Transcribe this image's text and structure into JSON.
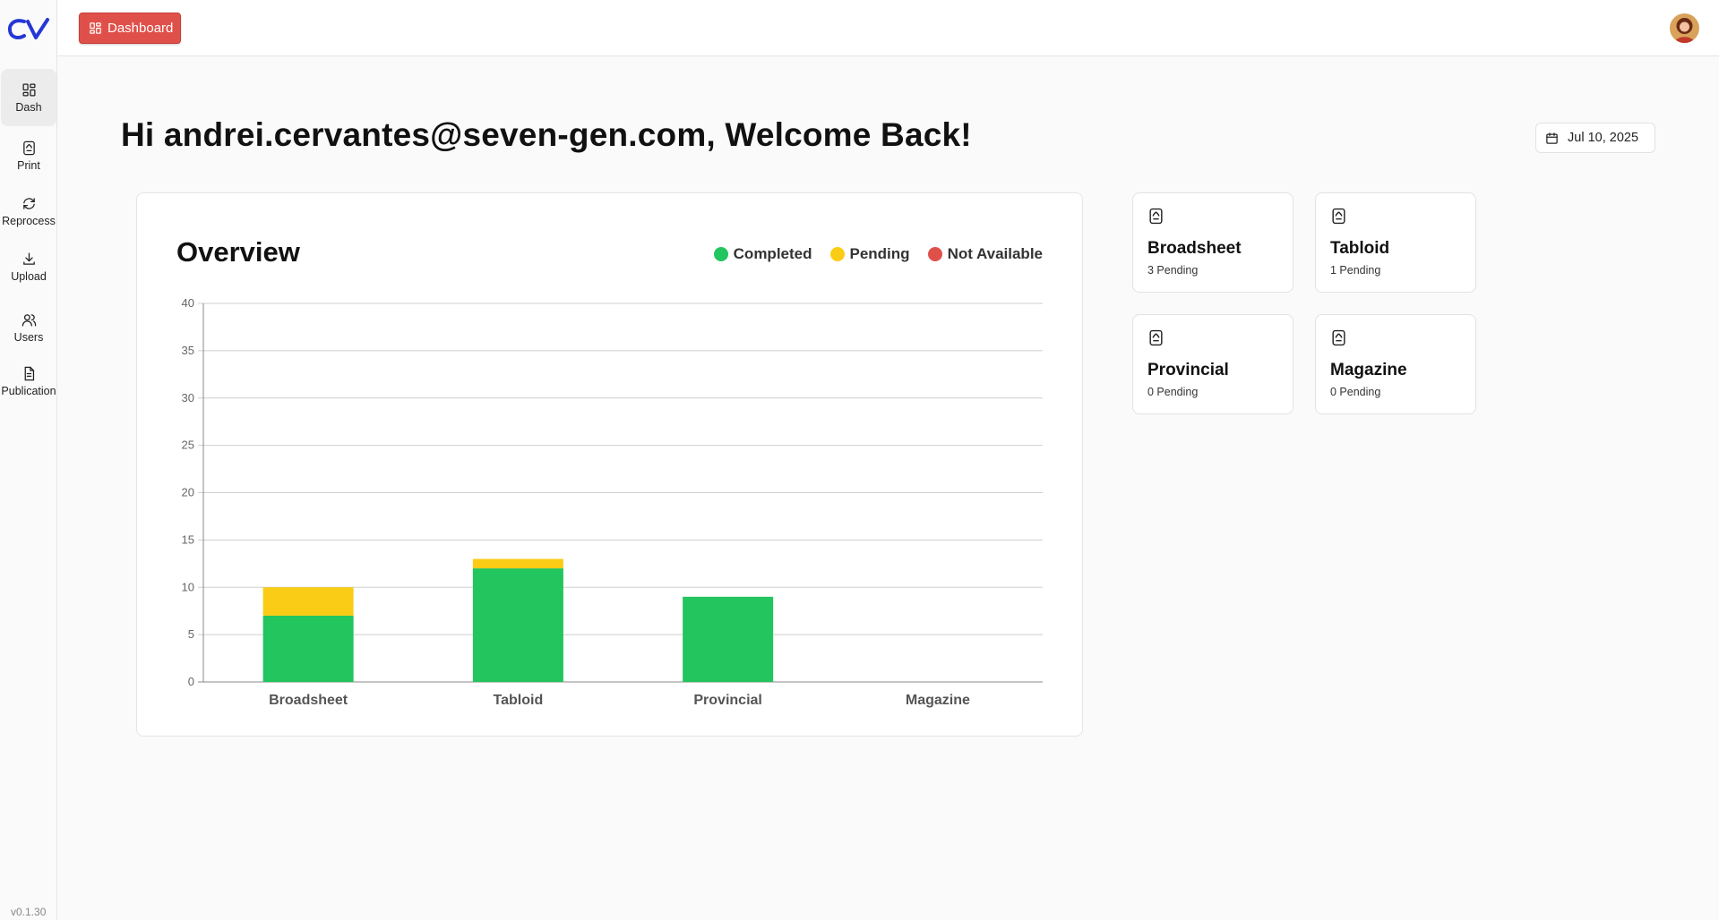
{
  "app": {
    "logo_text": "CV",
    "version": "v0.1.30"
  },
  "sidebar": {
    "items": [
      {
        "label": "Dash",
        "icon": "grid-icon",
        "active": true
      },
      {
        "label": "Print",
        "icon": "print-file-icon",
        "active": false
      },
      {
        "label": "Reprocess",
        "icon": "refresh-icon",
        "active": false
      },
      {
        "label": "Upload",
        "icon": "upload-icon",
        "active": false
      },
      {
        "label": "Users",
        "icon": "users-icon",
        "active": false
      },
      {
        "label": "Publication",
        "icon": "file-text-icon",
        "active": false
      }
    ]
  },
  "topbar": {
    "dashboard_button": "Dashboard"
  },
  "main": {
    "greeting": "Hi andrei.cervantes@seven-gen.com, Welcome Back!",
    "date": "Jul 10, 2025"
  },
  "overview": {
    "title": "Overview",
    "legend": [
      {
        "label": "Completed",
        "color": "#22c55e"
      },
      {
        "label": "Pending",
        "color": "#facc15"
      },
      {
        "label": "Not Available",
        "color": "#e0504a"
      }
    ]
  },
  "chart_data": {
    "type": "bar",
    "stacked": true,
    "categories": [
      "Broadsheet",
      "Tabloid",
      "Provincial",
      "Magazine"
    ],
    "series": [
      {
        "name": "Completed",
        "color": "#22c55e",
        "values": [
          7,
          12,
          9,
          0
        ]
      },
      {
        "name": "Pending",
        "color": "#facc15",
        "values": [
          3,
          1,
          0,
          0
        ]
      },
      {
        "name": "Not Available",
        "color": "#e0504a",
        "values": [
          0,
          0,
          0,
          0
        ]
      }
    ],
    "ylim": [
      0,
      40
    ],
    "yticks": [
      0,
      5,
      10,
      15,
      20,
      25,
      30,
      35,
      40
    ],
    "grid": true,
    "legend_position": "top-right",
    "title": "Overview",
    "xlabel": "",
    "ylabel": ""
  },
  "cards": [
    {
      "title": "Broadsheet",
      "subtitle": "3 Pending"
    },
    {
      "title": "Tabloid",
      "subtitle": "1 Pending"
    },
    {
      "title": "Provincial",
      "subtitle": "0 Pending"
    },
    {
      "title": "Magazine",
      "subtitle": "0 Pending"
    }
  ],
  "colors": {
    "accent": "#e0504a",
    "logo": "#2437d6"
  }
}
